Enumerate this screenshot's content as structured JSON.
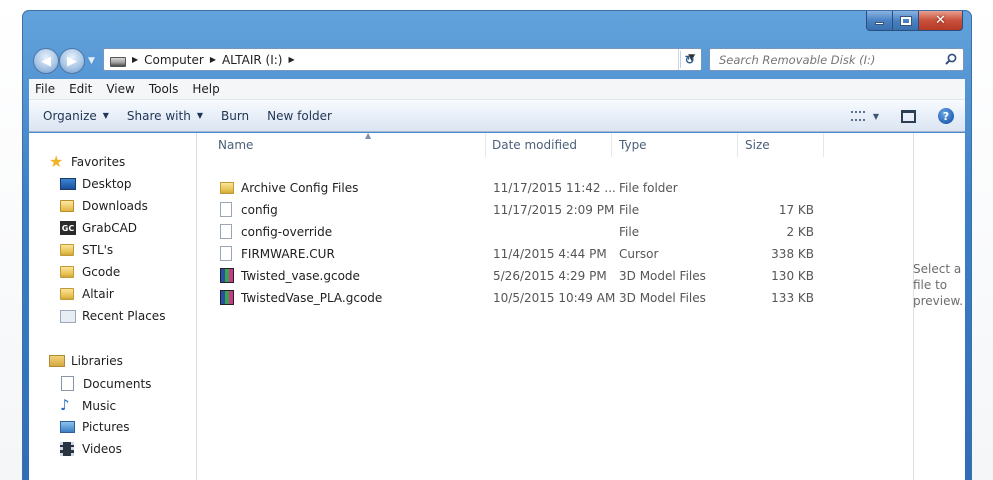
{
  "window": {
    "controls": {
      "minimize": "–",
      "close": "✕"
    }
  },
  "nav": {
    "back_glyph": "◀",
    "forward_glyph": "▶",
    "breadcrumbs": [
      "Computer",
      "ALTAIR (I:)"
    ],
    "refresh_glyph": "↻",
    "search_placeholder": "Search Removable Disk (I:)"
  },
  "menubar": {
    "items": [
      "File",
      "Edit",
      "View",
      "Tools",
      "Help"
    ]
  },
  "commandbar": {
    "organize": "Organize",
    "share_with": "Share with",
    "burn": "Burn",
    "new_folder": "New folder",
    "help_glyph": "?"
  },
  "navpane": {
    "favorites": {
      "label": "Favorites",
      "items": [
        "Desktop",
        "Downloads",
        "GrabCAD",
        "STL's",
        "Gcode",
        "Altair",
        "Recent Places"
      ]
    },
    "grabcad_badge": "GC",
    "libraries": {
      "label": "Libraries",
      "items": [
        "Documents",
        "Music",
        "Pictures",
        "Videos"
      ]
    }
  },
  "filelist": {
    "columns": [
      "Name",
      "Date modified",
      "Type",
      "Size"
    ],
    "rows": [
      {
        "name": "Archive Config Files",
        "date": "11/17/2015 11:42 ...",
        "type": "File folder",
        "size": "",
        "icon": "folder-icon"
      },
      {
        "name": "config",
        "date": "11/17/2015 2:09 PM",
        "type": "File",
        "size": "17 KB",
        "icon": "file-icon"
      },
      {
        "name": "config-override",
        "date": "",
        "type": "File",
        "size": "2 KB",
        "icon": "file-icon"
      },
      {
        "name": "FIRMWARE.CUR",
        "date": "11/4/2015 4:44 PM",
        "type": "Cursor",
        "size": "338 KB",
        "icon": "file-icon"
      },
      {
        "name": "Twisted_vase.gcode",
        "date": "5/26/2015 4:29 PM",
        "type": "3D Model Files",
        "size": "130 KB",
        "icon": "model-file-icon"
      },
      {
        "name": "TwistedVase_PLA.gcode",
        "date": "10/5/2015 10:49 AM",
        "type": "3D Model Files",
        "size": "133 KB",
        "icon": "model-file-icon"
      }
    ]
  },
  "preview": {
    "text": "Select a file to preview."
  }
}
